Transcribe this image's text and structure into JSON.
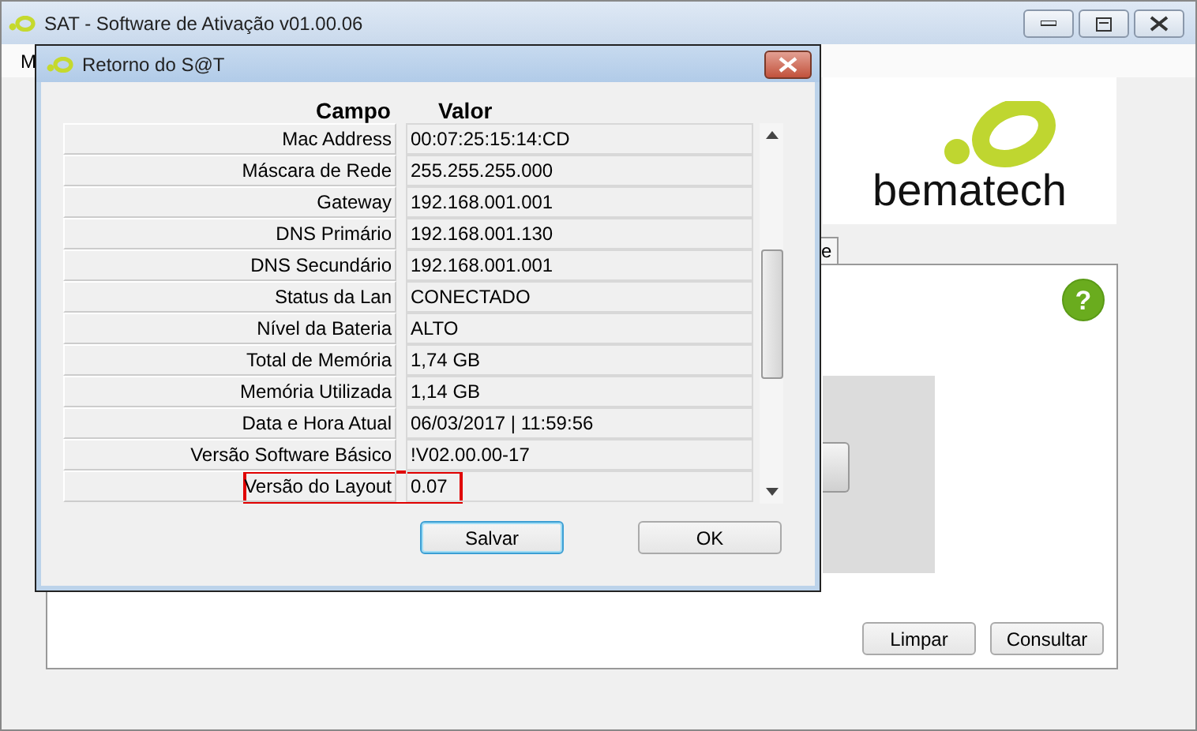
{
  "window": {
    "title": "SAT - Software de Ativação v01.00.06"
  },
  "menu": [
    "M"
  ],
  "logo": "bematech",
  "help": "?",
  "tabs": [
    {
      "label": "e",
      "selected": false
    }
  ],
  "buttons": [
    "Limpar",
    "Consultar"
  ],
  "dialog": {
    "title": "Retorno do S@T",
    "columns": [
      "Campo",
      "Valor"
    ],
    "rows": [
      {
        "field": "Mac Address",
        "value": "00:07:25:15:14:CD",
        "highlighted": false
      },
      {
        "field": "Máscara de Rede",
        "value": "255.255.255.000",
        "highlighted": false
      },
      {
        "field": "Gateway",
        "value": "192.168.001.001",
        "highlighted": false
      },
      {
        "field": "DNS Primário",
        "value": "192.168.001.130",
        "highlighted": false
      },
      {
        "field": "DNS Secundário",
        "value": "192.168.001.001",
        "highlighted": false
      },
      {
        "field": "Status da Lan",
        "value": "CONECTADO",
        "highlighted": false
      },
      {
        "field": "Nível da Bateria",
        "value": "ALTO",
        "highlighted": false
      },
      {
        "field": "Total de Memória",
        "value": "1,74 GB",
        "highlighted": false
      },
      {
        "field": "Memória Utilizada",
        "value": "1,14 GB",
        "highlighted": false
      },
      {
        "field": "Data e Hora Atual",
        "value": "06/03/2017 | 11:59:56",
        "highlighted": false
      },
      {
        "field": "Versão Software Básico",
        "value": "!V02.00.00-17",
        "highlighted": false
      },
      {
        "field": "Versão do Layout",
        "value": "0.07",
        "highlighted": true
      }
    ],
    "buttons": [
      {
        "label": "Salvar",
        "focused": true
      },
      {
        "label": "OK",
        "focused": false
      }
    ]
  }
}
